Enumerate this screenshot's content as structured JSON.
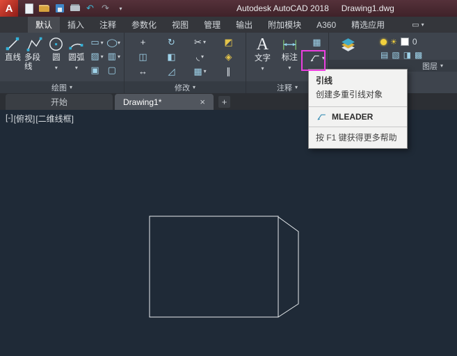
{
  "titlebar": {
    "logo_letter": "A",
    "app_title": "Autodesk AutoCAD 2018",
    "doc_title": "Drawing1.dwg"
  },
  "quick_access": {
    "undo_glyph": "↶",
    "redo_glyph": "↷",
    "caret": "▾"
  },
  "ribbon": {
    "tabs": [
      {
        "label": "默认"
      },
      {
        "label": "插入"
      },
      {
        "label": "注释"
      },
      {
        "label": "参数化"
      },
      {
        "label": "视图"
      },
      {
        "label": "管理"
      },
      {
        "label": "输出"
      },
      {
        "label": "附加模块"
      },
      {
        "label": "A360"
      },
      {
        "label": "精选应用"
      }
    ],
    "panels": {
      "draw": {
        "label": "绘图",
        "line": "直线",
        "polyline": "多段线",
        "circle": "圆",
        "arc": "圆弧"
      },
      "modify": {
        "label": "修改"
      },
      "annotate": {
        "label": "注释",
        "text": "文字",
        "dimension": "标注"
      },
      "layers": {
        "label": "图层",
        "current_layer": "0"
      }
    }
  },
  "icons": {
    "text_glyph": "A",
    "rectangle": "▭",
    "ellipse": "◯",
    "hatch": "▨",
    "gradient": "▥",
    "region": "▣",
    "boundary": "▢",
    "move": "+",
    "rotate": "↻",
    "trim": "✂",
    "erase": "◩",
    "copy": "◫",
    "mirror": "◧",
    "fillet": "◟",
    "explode": "◈",
    "stretch": "↔",
    "scale": "◿",
    "array": "▦",
    "offset": "∥",
    "table": "▦",
    "sun": "☀",
    "swatch": "■",
    "lt1": "▤",
    "lt2": "▧",
    "lt3": "◨",
    "lt4": "▩",
    "caret": "▾",
    "ribbon_toggle": "▭"
  },
  "tooltip": {
    "title": "引线",
    "description": "创建多重引线对象",
    "command": "MLEADER",
    "help": "按 F1 键获得更多帮助"
  },
  "file_tabs": {
    "start": "开始",
    "drawing": "Drawing1*",
    "close": "×",
    "add": "+"
  },
  "viewport_controls": {
    "minus": "[-]",
    "view": "[俯视]",
    "visual_style": "[二维线框]"
  }
}
